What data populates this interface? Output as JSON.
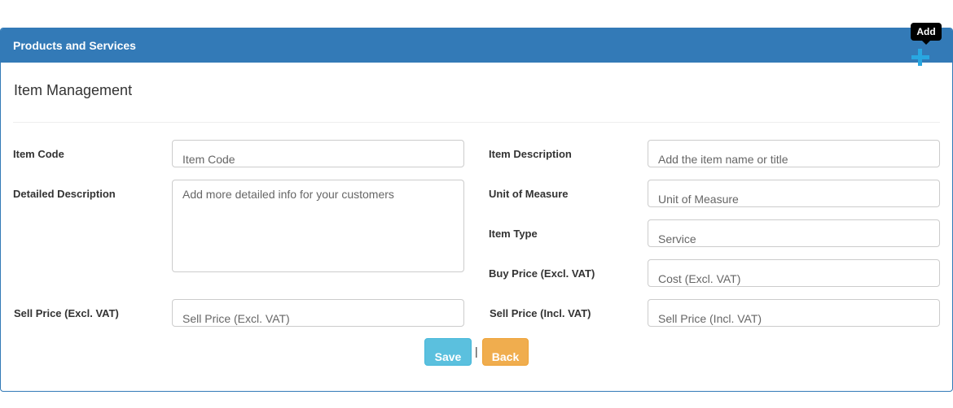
{
  "panel": {
    "heading": "Products and Services",
    "section_title": "Item Management",
    "add_tooltip": "Add",
    "add_icon": "plus-icon",
    "accent_color": "#337ab7"
  },
  "form": {
    "item_code": {
      "label": "Item Code",
      "placeholder": "Item Code",
      "value": ""
    },
    "item_description": {
      "label": "Item Description",
      "placeholder": "Add the item name or title",
      "value": ""
    },
    "detailed_description": {
      "label": "Detailed Description",
      "placeholder": "Add more detailed info for your customers",
      "value": ""
    },
    "unit_of_measure": {
      "label": "Unit of Measure",
      "placeholder": "Unit of Measure",
      "value": ""
    },
    "item_type": {
      "label": "Item Type",
      "placeholder": "Service",
      "value": ""
    },
    "buy_price": {
      "label": "Buy Price (Excl. VAT)",
      "placeholder": "Cost (Excl. VAT)",
      "value": ""
    },
    "sell_price_excl": {
      "label": "Sell Price (Excl. VAT)",
      "placeholder": "Sell Price (Excl. VAT)",
      "value": ""
    },
    "sell_price_incl": {
      "label": "Sell Price (Incl. VAT)",
      "placeholder": "Sell Price (Incl. VAT)",
      "value": ""
    }
  },
  "actions": {
    "save_label": "Save",
    "separator": "|",
    "back_label": "Back",
    "save_color": "#5bc0de",
    "back_color": "#f0ad4e"
  }
}
